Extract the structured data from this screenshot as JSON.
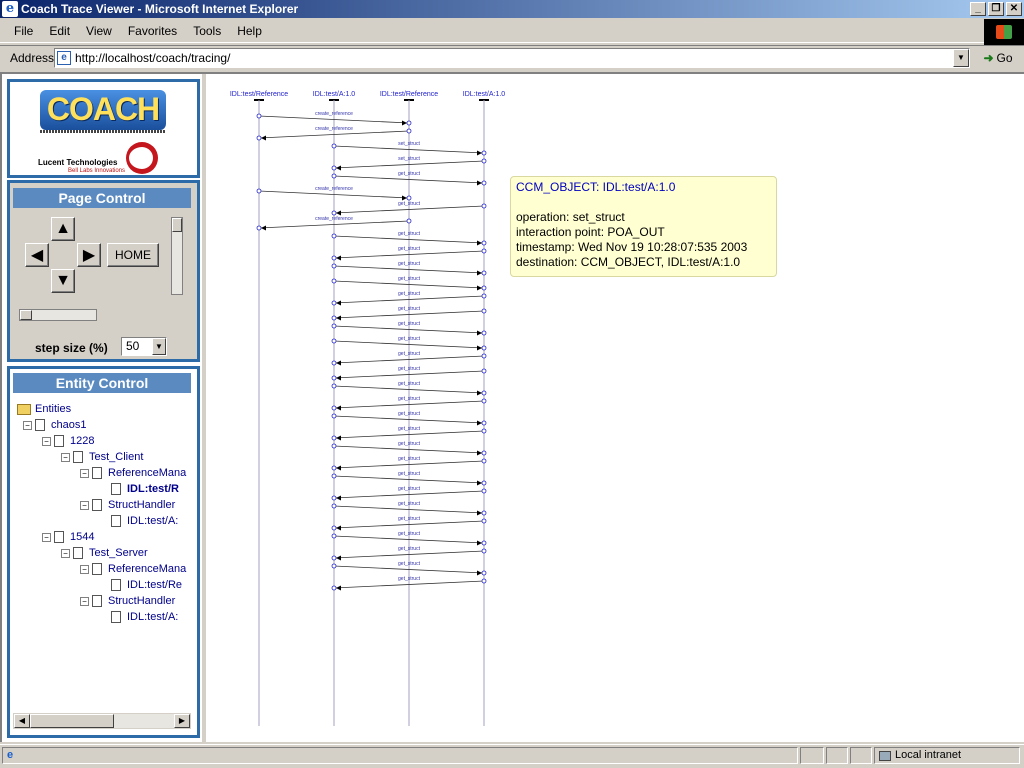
{
  "window": {
    "title": "Coach Trace Viewer - Microsoft Internet Explorer",
    "icon": "ie-icon"
  },
  "menu": [
    "File",
    "Edit",
    "View",
    "Favorites",
    "Tools",
    "Help"
  ],
  "address": {
    "label": "Address",
    "url": "http://localhost/coach/tracing/",
    "go_label": "Go"
  },
  "logo": {
    "coach": "COACH",
    "lucent": "Lucent Technologies",
    "lucent_sub": "Bell Labs Innovations"
  },
  "page_control": {
    "title": "Page Control",
    "home_label": "HOME",
    "step_label": "step size (%)",
    "step_value": "50"
  },
  "entity_control": {
    "title": "Entity Control",
    "tree": [
      {
        "label": "Entities",
        "depth": 0,
        "kind": "folder",
        "bold": false
      },
      {
        "label": "chaos1",
        "depth": 1,
        "kind": "doc",
        "bold": false
      },
      {
        "label": "1228",
        "depth": 2,
        "kind": "doc",
        "bold": false
      },
      {
        "label": "Test_Client",
        "depth": 3,
        "kind": "doc",
        "bold": false
      },
      {
        "label": "ReferenceMana",
        "depth": 4,
        "kind": "doc",
        "bold": false
      },
      {
        "label": "IDL:test/R",
        "depth": 5,
        "kind": "doc",
        "bold": true
      },
      {
        "label": "StructHandler",
        "depth": 4,
        "kind": "doc",
        "bold": false
      },
      {
        "label": "IDL:test/A:",
        "depth": 5,
        "kind": "doc",
        "bold": false
      },
      {
        "label": "1544",
        "depth": 2,
        "kind": "doc",
        "bold": false
      },
      {
        "label": "Test_Server",
        "depth": 3,
        "kind": "doc",
        "bold": false
      },
      {
        "label": "ReferenceMana",
        "depth": 4,
        "kind": "doc",
        "bold": false
      },
      {
        "label": "IDL:test/Re",
        "depth": 5,
        "kind": "doc",
        "bold": false
      },
      {
        "label": "StructHandler",
        "depth": 4,
        "kind": "doc",
        "bold": false
      },
      {
        "label": "IDL:test/A:",
        "depth": 5,
        "kind": "doc",
        "bold": false
      }
    ]
  },
  "sequence": {
    "lifelines": [
      "IDL:test/Reference",
      "IDL:test/A:1.0",
      "IDL:test/Reference",
      "IDL:test/A:1.0"
    ],
    "messages": [
      {
        "label": "create_reference",
        "from": 0,
        "to": 2
      },
      {
        "label": "create_reference",
        "from": 2,
        "to": 0
      },
      {
        "label": "set_struct",
        "from": 1,
        "to": 3
      },
      {
        "label": "set_struct",
        "from": 3,
        "to": 1
      },
      {
        "label": "get_struct",
        "from": 1,
        "to": 3
      },
      {
        "label": "create_reference",
        "from": 0,
        "to": 2
      },
      {
        "label": "get_struct",
        "from": 3,
        "to": 1
      },
      {
        "label": "create_reference",
        "from": 2,
        "to": 0
      },
      {
        "label": "get_struct",
        "from": 1,
        "to": 3
      },
      {
        "label": "get_struct",
        "from": 3,
        "to": 1
      },
      {
        "label": "get_struct",
        "from": 1,
        "to": 3
      },
      {
        "label": "get_struct",
        "from": 1,
        "to": 3
      },
      {
        "label": "get_struct",
        "from": 3,
        "to": 1
      },
      {
        "label": "get_struct",
        "from": 3,
        "to": 1
      },
      {
        "label": "get_struct",
        "from": 1,
        "to": 3
      },
      {
        "label": "get_struct",
        "from": 1,
        "to": 3
      },
      {
        "label": "get_struct",
        "from": 3,
        "to": 1
      },
      {
        "label": "get_struct",
        "from": 3,
        "to": 1
      },
      {
        "label": "get_struct",
        "from": 1,
        "to": 3
      },
      {
        "label": "get_struct",
        "from": 3,
        "to": 1
      },
      {
        "label": "get_struct",
        "from": 1,
        "to": 3
      },
      {
        "label": "get_struct",
        "from": 3,
        "to": 1
      },
      {
        "label": "get_struct",
        "from": 1,
        "to": 3
      },
      {
        "label": "get_struct",
        "from": 3,
        "to": 1
      },
      {
        "label": "get_struct",
        "from": 1,
        "to": 3
      },
      {
        "label": "get_struct",
        "from": 3,
        "to": 1
      },
      {
        "label": "get_struct",
        "from": 1,
        "to": 3
      },
      {
        "label": "get_struct",
        "from": 3,
        "to": 1
      },
      {
        "label": "get_struct",
        "from": 1,
        "to": 3
      },
      {
        "label": "get_struct",
        "from": 3,
        "to": 1
      },
      {
        "label": "get_struct",
        "from": 1,
        "to": 3
      },
      {
        "label": "get_struct",
        "from": 3,
        "to": 1
      }
    ]
  },
  "tooltip": {
    "title": "CCM_OBJECT: IDL:test/A:1.0",
    "operation": "operation: set_struct",
    "interaction_point": "interaction point: POA_OUT",
    "timestamp": "timestamp: Wed Nov 19 10:28:07:535 2003",
    "destination": "destination: CCM_OBJECT, IDL:test/A:1.0"
  },
  "status": {
    "zone": "Local intranet"
  },
  "colors": {
    "diagram_line": "#2222cc",
    "diagram_label": "#3333aa",
    "panel_border": "#2d6aa8",
    "panel_head": "#5a8ac0",
    "tooltip_bg": "#ffffd2"
  }
}
